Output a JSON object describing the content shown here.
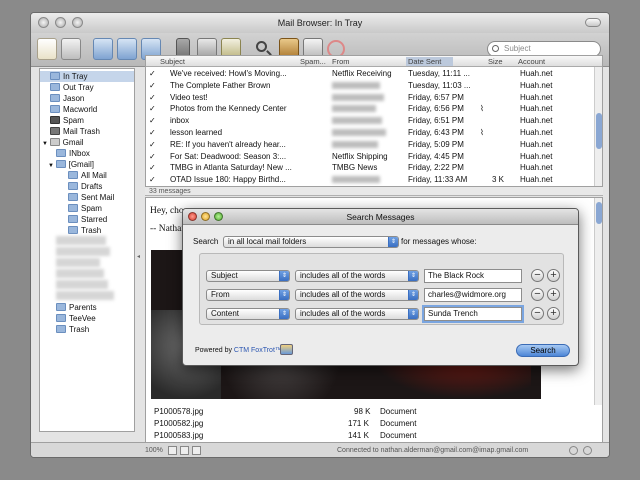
{
  "window": {
    "title": "Mail Browser: In Tray"
  },
  "search": {
    "placeholder": "Subject"
  },
  "sidebar": {
    "items": [
      {
        "label": "In Tray",
        "selected": true
      },
      {
        "label": "Out Tray"
      },
      {
        "label": "Jason"
      },
      {
        "label": "Macworld"
      },
      {
        "label": "Spam"
      },
      {
        "label": "Mail Trash"
      },
      {
        "label": "Gmail"
      },
      {
        "label": "INbox"
      },
      {
        "label": "[Gmail]"
      },
      {
        "label": "All Mail"
      },
      {
        "label": "Drafts"
      },
      {
        "label": "Sent Mail"
      },
      {
        "label": "Spam"
      },
      {
        "label": "Starred"
      },
      {
        "label": "Trash"
      },
      {
        "label": "Parents"
      },
      {
        "label": "TeeVee"
      },
      {
        "label": "Trash"
      }
    ]
  },
  "messages": {
    "columns": [
      "Subject",
      "Spam...",
      "From",
      "Date Sent",
      "Size",
      "Account"
    ],
    "rows": [
      {
        "subject": "We've received: Howl's Moving...",
        "from": "Netflix Receiving",
        "date": "Tuesday, 11:11 ...",
        "size": "",
        "account": "Huah.net"
      },
      {
        "subject": "The Complete Father Brown",
        "from": "",
        "date": "Tuesday, 11:03 ...",
        "size": "",
        "account": "Huah.net"
      },
      {
        "subject": "Video test!",
        "from": "",
        "date": "Friday, 6:57 PM",
        "size": "",
        "account": "Huah.net"
      },
      {
        "subject": "Photos from the Kennedy Center",
        "from": "",
        "date": "Friday, 6:56 PM",
        "size": "",
        "account": "Huah.net"
      },
      {
        "subject": "inbox",
        "from": "",
        "date": "Friday, 6:51 PM",
        "size": "",
        "account": "Huah.net"
      },
      {
        "subject": "lesson learned",
        "from": "",
        "date": "Friday, 6:43 PM",
        "size": "",
        "account": "Huah.net"
      },
      {
        "subject": "RE: If you haven't already hear...",
        "from": "",
        "date": "Friday, 5:09 PM",
        "size": "",
        "account": "Huah.net"
      },
      {
        "subject": "For Sat: Deadwood: Season 3:...",
        "from": "Netflix Shipping",
        "date": "Friday, 4:45 PM",
        "size": "",
        "account": "Huah.net"
      },
      {
        "subject": "TMBG in Atlanta Saturday! New ...",
        "from": "TMBG News",
        "date": "Friday, 2:22 PM",
        "size": "",
        "account": "Huah.net"
      },
      {
        "subject": "OTAD Issue 180: Happy Birthd...",
        "from": "",
        "date": "Friday, 11:33 AM",
        "size": "3 K",
        "account": "Huah.net"
      }
    ],
    "count": "33 messages"
  },
  "preview": {
    "greeting": "Hey, cho",
    "signature": "-- Nathan"
  },
  "attachments": [
    {
      "name": "P1000578.jpg",
      "size": "98 K",
      "kind": "Document"
    },
    {
      "name": "P1000582.jpg",
      "size": "171 K",
      "kind": "Document"
    },
    {
      "name": "P1000583.jpg",
      "size": "141 K",
      "kind": "Document"
    }
  ],
  "status": {
    "zoom": "100%",
    "connection": "Connected to nathan.alderman@gmail.com@imap.gmail.com"
  },
  "dialog": {
    "title": "Search Messages",
    "search_label": "Search",
    "scope": "in all local mail folders",
    "scope_suffix": "for messages whose:",
    "criteria": [
      {
        "field": "Subject",
        "op": "includes all of the words",
        "value": "The Black Rock"
      },
      {
        "field": "From",
        "op": "includes all of the words",
        "value": "charles@widmore.org"
      },
      {
        "field": "Content",
        "op": "includes all of the words",
        "value": "Sunda Trench"
      }
    ],
    "powered_by": "Powered by",
    "vendor": "CTM FoxTrot™",
    "search_button": "Search"
  },
  "colors": {
    "accent": "#4d86d6",
    "selection": "#c5d5ea",
    "envelope": "#e57b2e"
  }
}
